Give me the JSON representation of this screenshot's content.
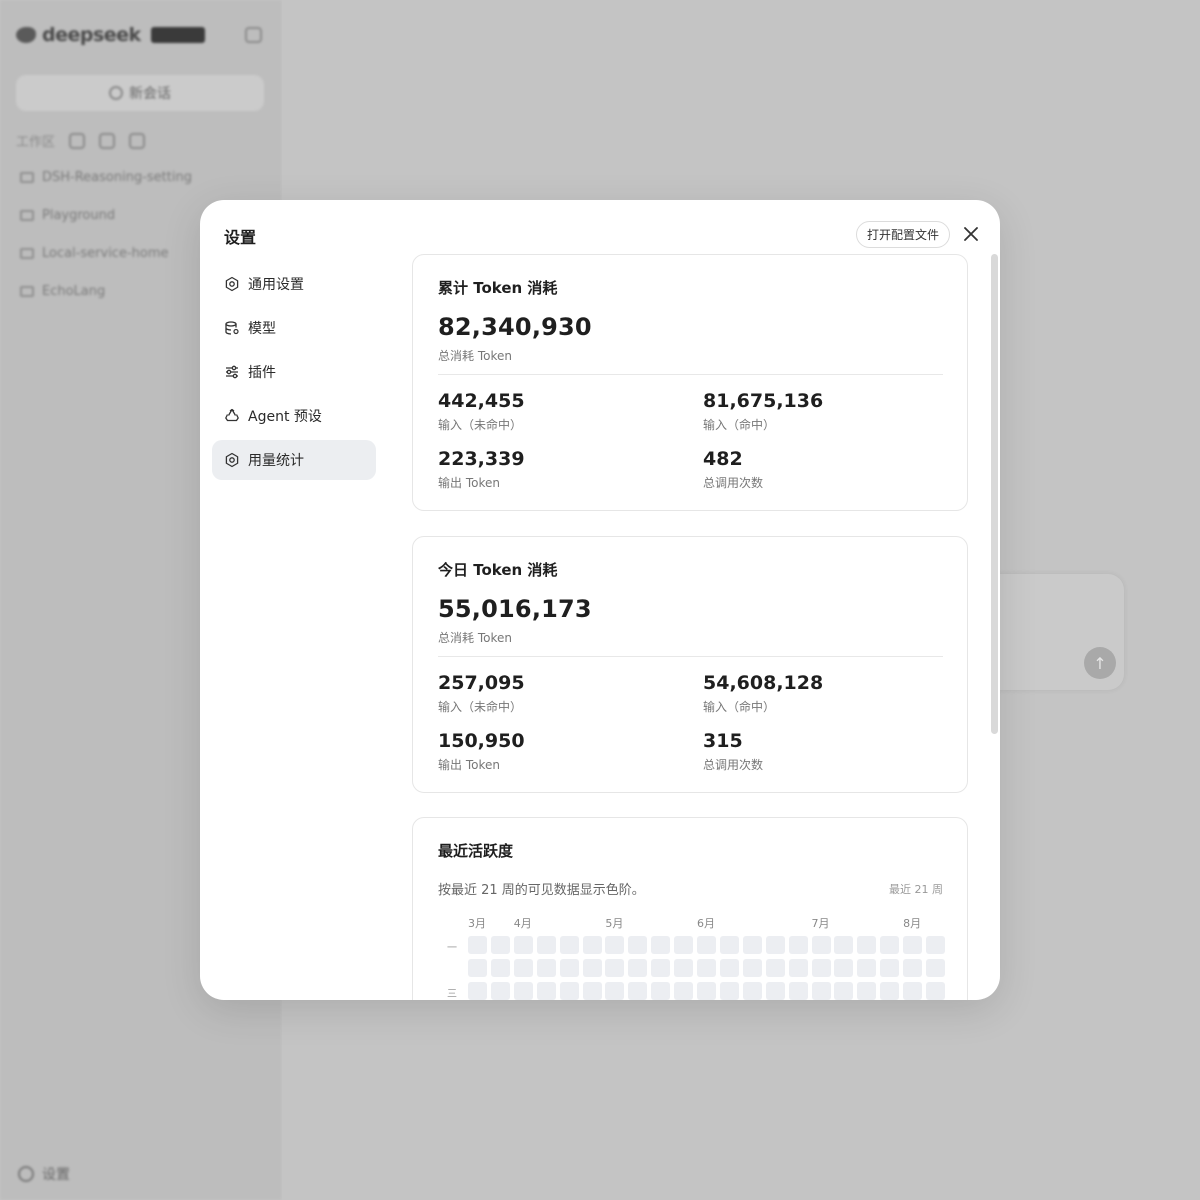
{
  "background": {
    "brand": "deepseek",
    "new_chat": "新会话",
    "workspace": "工作区",
    "folders": [
      "DSH-Reasoning-setting",
      "Playground",
      "Local-service-home",
      "EchoLang"
    ],
    "settings": "设置"
  },
  "modal": {
    "title": "设置",
    "open_config": "打开配置文件",
    "nav": [
      {
        "label": "通用设置",
        "icon": "gear-icon"
      },
      {
        "label": "模型",
        "icon": "database-icon"
      },
      {
        "label": "插件",
        "icon": "sliders-icon"
      },
      {
        "label": "Agent 预设",
        "icon": "recycle-icon"
      },
      {
        "label": "用量统计",
        "icon": "gear-icon",
        "active": true
      }
    ],
    "cumulative": {
      "title": "累计 Token 消耗",
      "total": "82,340,930",
      "total_label": "总消耗 Token",
      "input_miss": "442,455",
      "input_miss_label": "输入（未命中）",
      "input_hit": "81,675,136",
      "input_hit_label": "输入（命中）",
      "output": "223,339",
      "output_label": "输出 Token",
      "calls": "482",
      "calls_label": "总调用次数"
    },
    "today": {
      "title": "今日 Token 消耗",
      "total": "55,016,173",
      "total_label": "总消耗 Token",
      "input_miss": "257,095",
      "input_miss_label": "输入（未命中）",
      "input_hit": "54,608,128",
      "input_hit_label": "输入（命中）",
      "output": "150,950",
      "output_label": "输出 Token",
      "calls": "315",
      "calls_label": "总调用次数"
    },
    "activity": {
      "title": "最近活跃度",
      "description": "按最近 21 周的可见数据显示色阶。",
      "range": "最近 21 周",
      "months": [
        "3月",
        "4月",
        "5月",
        "6月",
        "7月",
        "8月"
      ],
      "month_weeks": [
        0,
        2,
        6,
        10,
        15,
        19
      ],
      "day_labels": [
        "一",
        "三"
      ],
      "weeks": 21,
      "visible_rows": 3,
      "cell_color": "#eceef2"
    }
  }
}
